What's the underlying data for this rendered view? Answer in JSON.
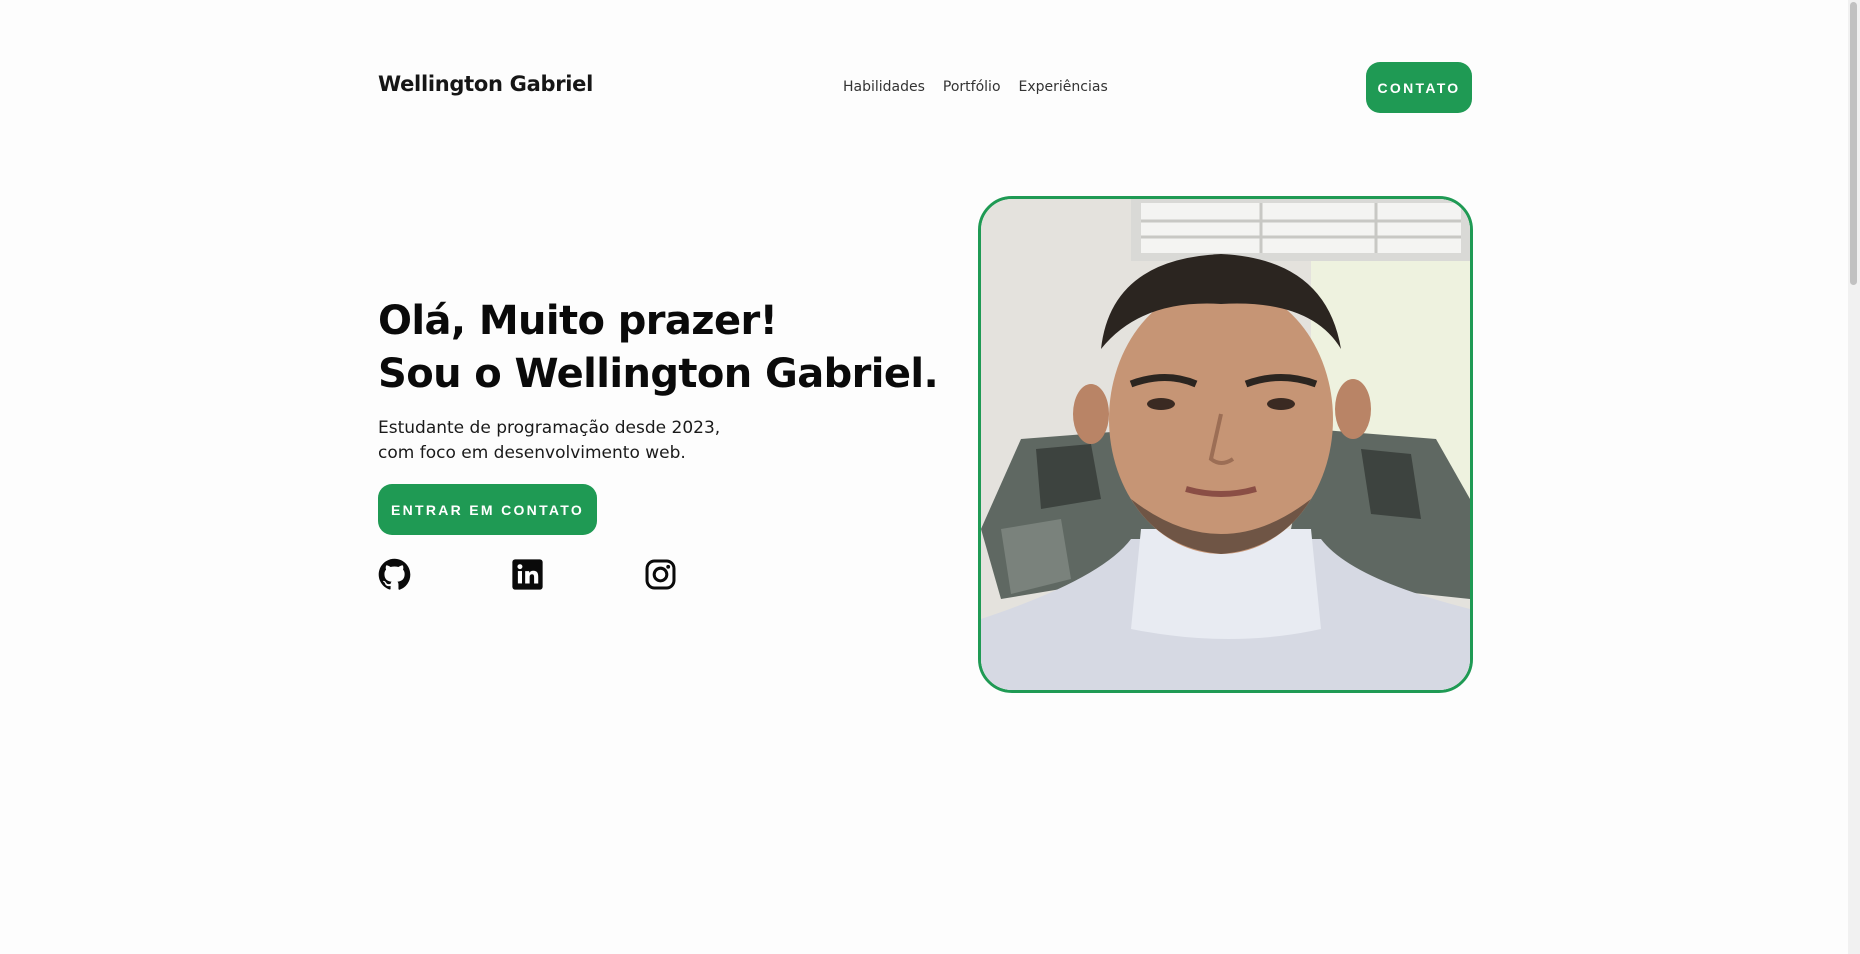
{
  "header": {
    "brand": "Wellington Gabriel",
    "nav": [
      "Habilidades",
      "Portfólio",
      "Experiências"
    ],
    "contact_button": "CONTATO"
  },
  "hero": {
    "title_line1": "Olá, Muito prazer!",
    "title_line2": "Sou o Wellington Gabriel.",
    "subtitle_line1": "Estudante de programação desde 2023,",
    "subtitle_line2": "com foco em desenvolvimento web.",
    "cta_button": "ENTRAR EM CONTATO",
    "socials": [
      "github-icon",
      "linkedin-icon",
      "instagram-icon"
    ]
  },
  "colors": {
    "accent": "#1f9a54",
    "background": "#fdfdfd",
    "text": "#0a0a0a"
  }
}
